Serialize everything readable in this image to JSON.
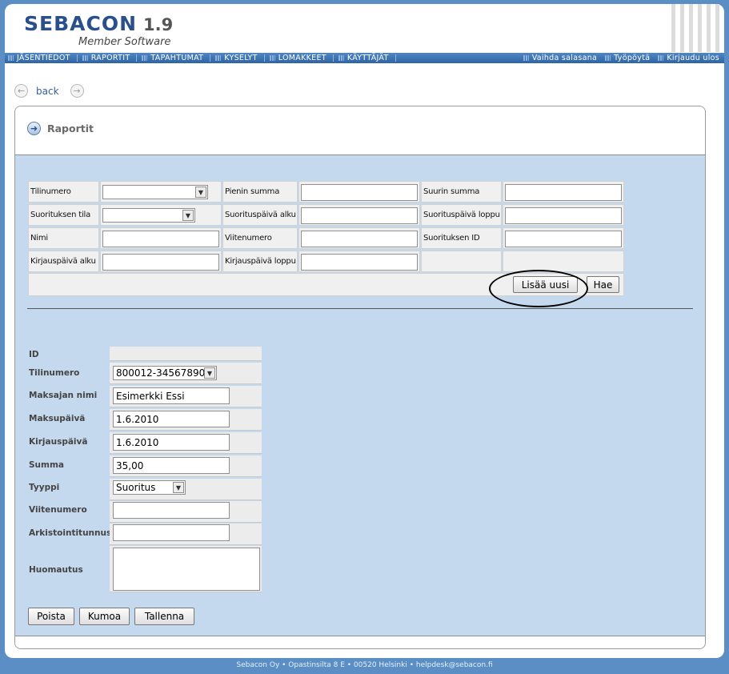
{
  "app": {
    "logo": "SEBACON",
    "version": "1.9",
    "subtitle": "Member Software"
  },
  "nav": {
    "items": [
      "JÄSENTIEDOT",
      "RAPORTIT",
      "TAPAHTUMAT",
      "KYSELYT",
      "LOMAKKEET",
      "KÄYTTÄJÄT"
    ],
    "right_items": [
      "Vaihda salasana",
      "Työpöytä",
      "Kirjaudu ulos"
    ]
  },
  "back_label": "back",
  "panel_title": "Raportit",
  "search": {
    "labels": {
      "tilinumero": "Tilinumero",
      "pienin_summa": "Pienin summa",
      "suurin_summa": "Suurin summa",
      "suorituksen_tila": "Suorituksen tila",
      "suorituspaiva_alku": "Suorituspäivä alku",
      "suorituspaiva_loppu": "Suorituspäivä loppu",
      "nimi": "Nimi",
      "viitenumero": "Viitenumero",
      "suorituksen_id": "Suorituksen ID",
      "kirjauspaiva_alku": "Kirjauspäivä alku",
      "kirjauspaiva_loppu": "Kirjauspäivä loppu"
    },
    "add_button": "Lisää uusi",
    "search_button": "Hae"
  },
  "form": {
    "labels": {
      "id": "ID",
      "tilinumero": "Tilinumero",
      "maksajan_nimi": "Maksajan nimi",
      "maksupaiva": "Maksupäivä",
      "kirjauspaiva": "Kirjauspäivä",
      "summa": "Summa",
      "tyyppi": "Tyyppi",
      "viitenumero": "Viitenumero",
      "arkistointitunnus": "Arkistointitunnus",
      "huomautus": "Huomautus"
    },
    "values": {
      "id": "",
      "tilinumero": "800012-34567890",
      "maksajan_nimi": "Esimerkki Essi",
      "maksupaiva": "1.6.2010",
      "kirjauspaiva": "1.6.2010",
      "summa": "35,00",
      "tyyppi": "Suoritus",
      "viitenumero": "",
      "arkistointitunnus": "",
      "huomautus": ""
    },
    "buttons": {
      "delete": "Poista",
      "cancel": "Kumoa",
      "save": "Tallenna"
    }
  },
  "footer": "Sebacon Oy • Opastinsilta 8 E • 00520 Helsinki • helpdesk@sebacon.fi",
  "colors": {
    "nav": "#3a6fae",
    "panel_bg": "#c5d9ee",
    "page_bg": "#5b8ec4",
    "logo": "#2a4f8a"
  },
  "icons": {
    "back": "circle-arrow-left-icon",
    "forward": "circle-arrow-right-icon",
    "panel": "circle-arrow-right-icon"
  }
}
